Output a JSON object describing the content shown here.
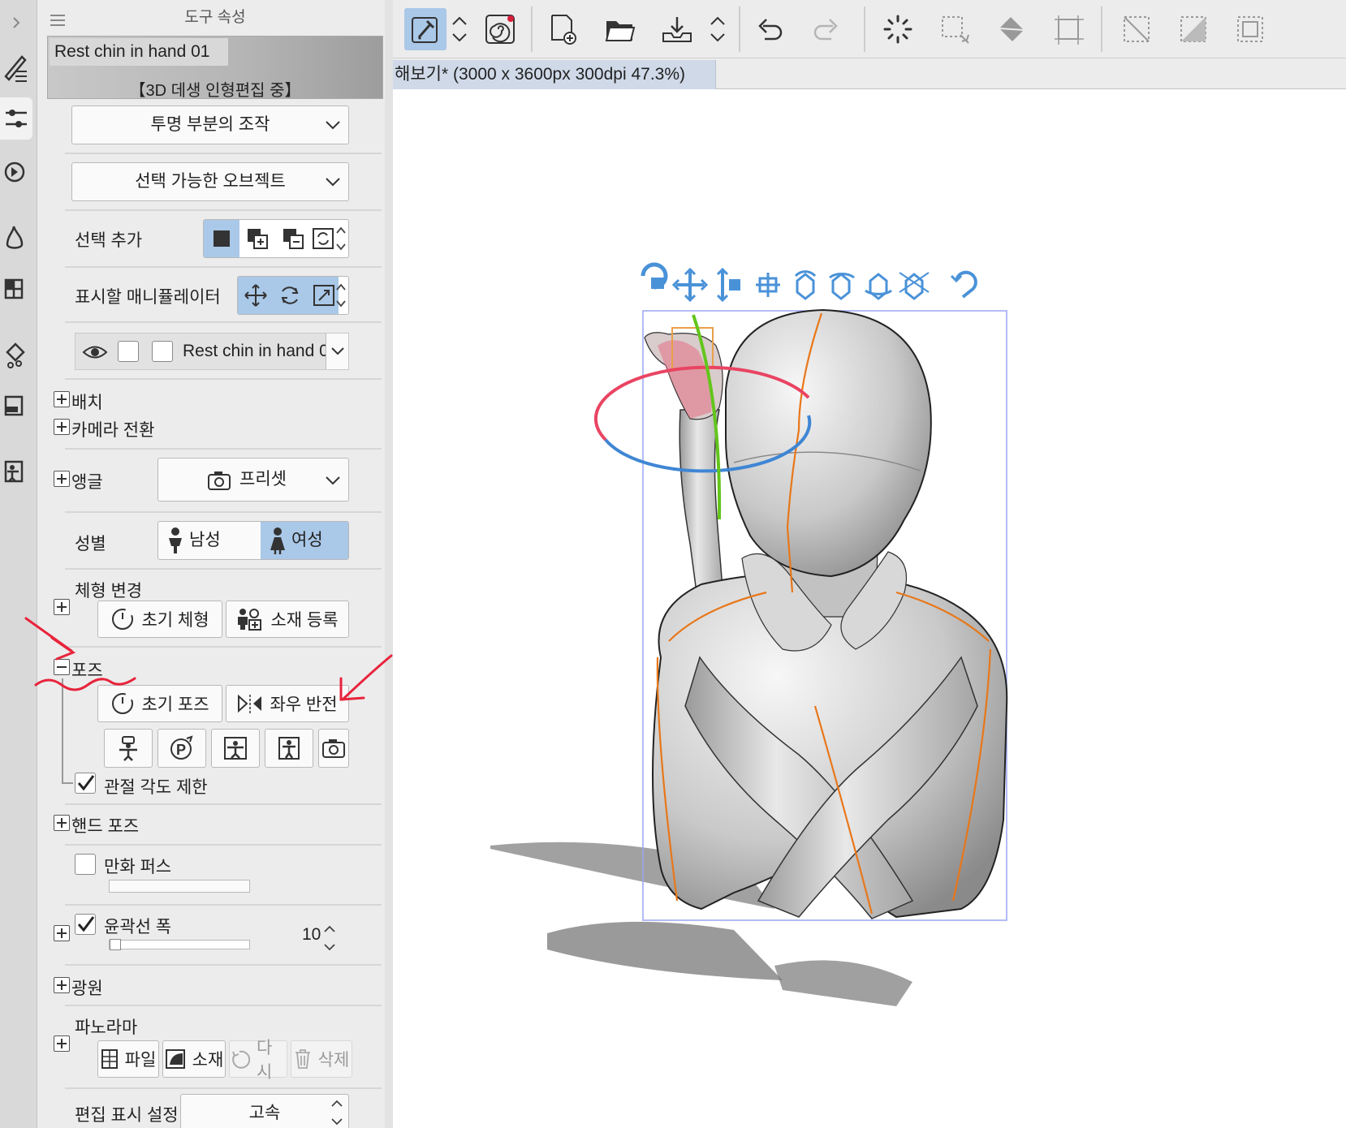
{
  "panel": {
    "title": "도구 속성",
    "subtool_name": "Rest chin in hand 01",
    "mode_label": "【3D 데생 인형편집 중】",
    "transparent_op": "투명 부분의 조작",
    "selectable_objects": "선택 가능한 오브젝트",
    "selection_add_label": "선택 추가",
    "manipulator_label": "표시할 매니퓰레이터",
    "object_name": "Rest chin in hand 01",
    "placement": "배치",
    "camera_switch": "카메라 전환",
    "angle": "앵글",
    "preset": "프리셋",
    "gender_label": "성별",
    "male": "남성",
    "female": "여성",
    "body_change": "체형 변경",
    "initial_body": "초기 체형",
    "register_material": "소재 등록",
    "pose": "포즈",
    "initial_pose": "초기 포즈",
    "flip_lr": "좌우 반전",
    "joint_limit": "관절 각도 제한",
    "hand_pose": "핸드 포즈",
    "manga_perspective": "만화 퍼스",
    "outline_width": "윤곽선 폭",
    "outline_width_value": "10",
    "light_source": "광원",
    "panorama": "파노라마",
    "pano_file": "파일",
    "pano_material": "소재",
    "pano_redo": "다시",
    "pano_delete": "삭제",
    "edit_display": "편집 표시 설정",
    "edit_display_value": "고속",
    "joint_limit_checked": true,
    "manga_perspective_checked": false,
    "outline_width_checked": true
  },
  "document": {
    "tab_title": "해보기* (3000 x 3600px 300dpi 47.3%)"
  },
  "colors": {
    "accent_selected": "#aac8e8",
    "annotation_red": "#e8243c",
    "gizmo_blue": "#3f86d4",
    "gizmo_red": "#e94462",
    "gizmo_green": "#63c51c",
    "bone_orange": "#e8771a"
  }
}
